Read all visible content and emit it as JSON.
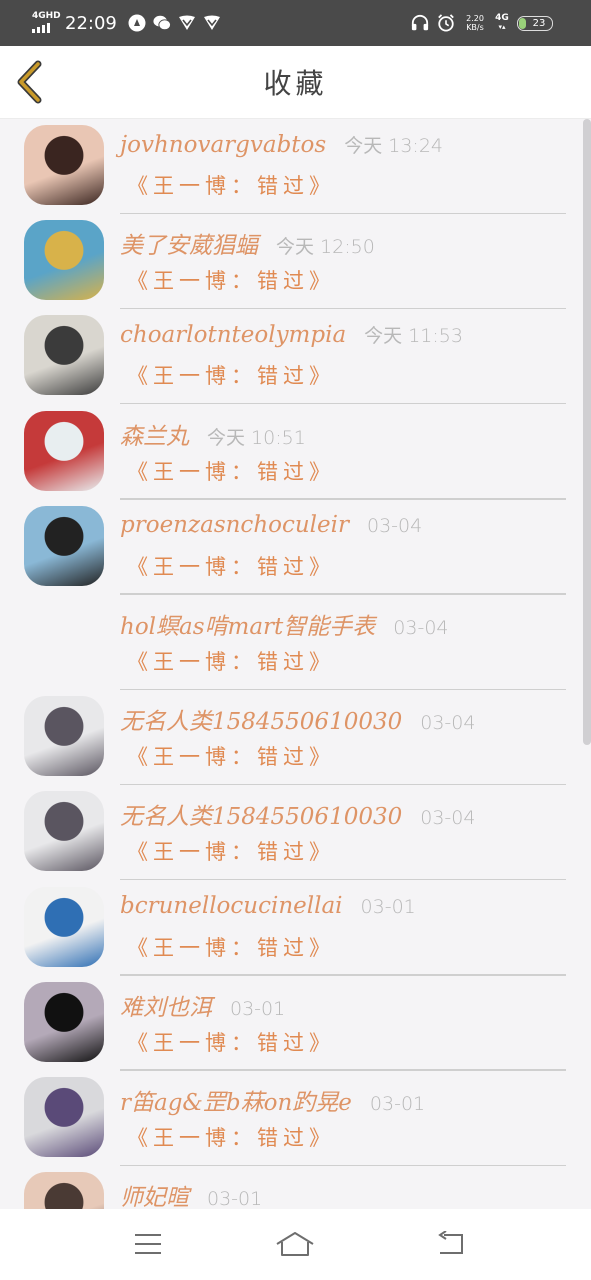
{
  "status_bar": {
    "network_label": "4GHD",
    "time": "22:09",
    "speed_top": "2.20",
    "speed_bottom": "KB/s",
    "mobile_label": "4G",
    "battery": "23"
  },
  "header": {
    "title": "收藏"
  },
  "favorites": [
    {
      "user": "jovhnovargvabtos",
      "time": "今天 13:24",
      "song": "《王一博：错过》",
      "avatar": "avatar-woman-dark-hair",
      "colors": [
        "#e9c6b4",
        "#3a2520"
      ]
    },
    {
      "user": "美了安葳猖蝠",
      "time": "今天 12:50",
      "song": "《王一博：错过》",
      "avatar": "avatar-cartoon-lion",
      "colors": [
        "#5aa4c8",
        "#d8b24a"
      ]
    },
    {
      "user": "choarlotnteolympia",
      "time": "今天 11:53",
      "song": "《王一博：错过》",
      "avatar": "avatar-two-people",
      "colors": [
        "#d9d6cf",
        "#3b3b3b"
      ]
    },
    {
      "user": "森兰丸",
      "time": "今天 10:51",
      "song": "《王一博：错过》",
      "avatar": "avatar-anime-white-hair",
      "colors": [
        "#c53a3a",
        "#e8eef0"
      ]
    },
    {
      "user": "proenzasnchoculeir",
      "time": "03-04",
      "song": "《王一博：错过》",
      "avatar": "avatar-comic-girl",
      "colors": [
        "#8ab8d6",
        "#222222"
      ]
    },
    {
      "user": "hol螟as啃mart智能手表",
      "time": "03-04",
      "song": "《王一博：错过》",
      "avatar": "",
      "colors": [
        "#f5f4f6",
        "#f5f4f6"
      ]
    },
    {
      "user": "无名人类1584550610030",
      "time": "03-04",
      "song": "《王一博：错过》",
      "avatar": "avatar-long-hair-grey",
      "colors": [
        "#e8e8ea",
        "#5a5560"
      ]
    },
    {
      "user": "无名人类1584550610030",
      "time": "03-04",
      "song": "《王一博：错过》",
      "avatar": "avatar-long-hair-grey",
      "colors": [
        "#e8e8ea",
        "#5a5560"
      ]
    },
    {
      "user": "bcrunellocucinellai",
      "time": "03-01",
      "song": "《王一博：错过》",
      "avatar": "avatar-cartoon-boy",
      "colors": [
        "#f2f2f2",
        "#2f6fb4"
      ]
    },
    {
      "user": "难刘也洱",
      "time": "03-01",
      "song": "《王一博：错过》",
      "avatar": "avatar-black-mug",
      "colors": [
        "#b4a9b8",
        "#111111"
      ]
    },
    {
      "user": "r笛ag&罡b菻on趵晃e",
      "time": "03-01",
      "song": "《王一博：错过》",
      "avatar": "avatar-flowers",
      "colors": [
        "#d9d9dc",
        "#5a4a78"
      ]
    },
    {
      "user": "师妃暄",
      "time": "03-01",
      "song": "",
      "avatar": "avatar-boy-face",
      "colors": [
        "#e7c9b8",
        "#4a3a34"
      ]
    }
  ],
  "navbar": {
    "menu_icon": "menu-icon",
    "home_icon": "home-icon",
    "back_icon": "return-icon"
  },
  "colors": {
    "accent": "#de9466",
    "title": "#444444",
    "timestamp": "#b8b8b8",
    "back_arrow": "#b98a1e"
  }
}
